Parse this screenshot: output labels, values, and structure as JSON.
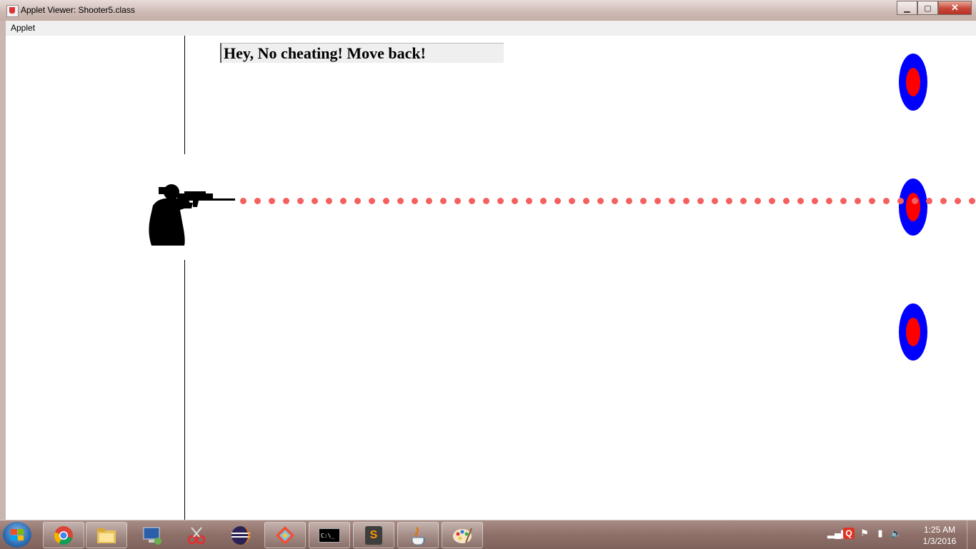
{
  "window": {
    "title": "Applet Viewer: Shooter5.class",
    "buttons": {
      "minimize": "▁",
      "maximize": "▢",
      "close": "✕"
    }
  },
  "menu": {
    "items": [
      "Applet"
    ]
  },
  "game": {
    "message": "Hey, No cheating! Move back!",
    "colors": {
      "target_outer": "#0000ff",
      "target_inner": "#ff0000",
      "bullet": "#f55f5f",
      "line": "#000000"
    }
  },
  "taskbar": {
    "apps": [
      "chrome-icon",
      "file-explorer-icon",
      "remote-desktop-icon",
      "snipping-tool-icon",
      "eclipse-icon",
      "git-icon",
      "command-prompt-icon",
      "sublime-text-icon",
      "java-icon",
      "paint-icon"
    ],
    "cmd_label": "C:\\_",
    "sublime_label": "S",
    "tray_badge": "Q",
    "clock": {
      "time": "1:25 AM",
      "date": "1/3/2016"
    }
  }
}
